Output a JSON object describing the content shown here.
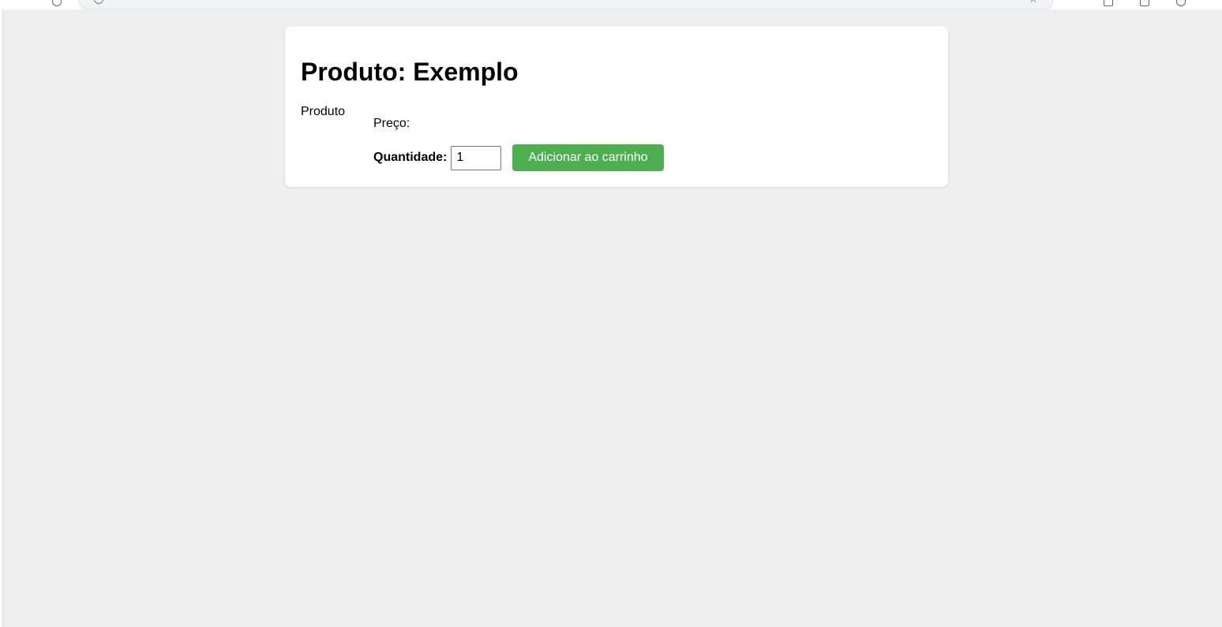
{
  "browser": {
    "address_icon": "info-icon",
    "bookmark_icon": "star-icon"
  },
  "product": {
    "title": "Produto: Exemplo",
    "image_alt": "Produto",
    "price_label": "Preço:",
    "price_value": "",
    "quantity_label": "Quantidade:",
    "quantity_value": "1",
    "add_to_cart_label": "Adicionar ao carrinho"
  },
  "colors": {
    "page_background": "#efefef",
    "card_background": "#ffffff",
    "button_background": "#4caf50",
    "button_text": "#ffffff"
  }
}
